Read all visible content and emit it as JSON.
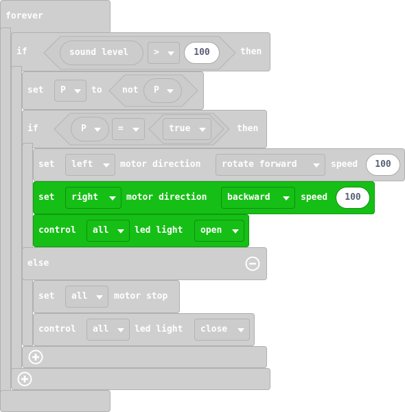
{
  "forever": {
    "label": "forever"
  },
  "if_outer": {
    "if_label": "if",
    "reporter": "sound level",
    "operator": ">",
    "value": "100",
    "then_label": "then"
  },
  "set_p": {
    "set_label": "set",
    "variable": "P",
    "to_label": "to",
    "not_label": "not",
    "not_arg": "P"
  },
  "if_inner": {
    "if_label": "if",
    "left_arg": "P",
    "operator": "=",
    "right_arg": "true",
    "then_label": "then"
  },
  "motor_left": {
    "set_label": "set",
    "side": "left",
    "motor_label": "motor direction",
    "direction": "rotate forward",
    "speed_label": "speed",
    "speed": "100"
  },
  "motor_right": {
    "set_label": "set",
    "side": "right",
    "motor_label": "motor direction",
    "direction": "backward",
    "speed_label": "speed",
    "speed": "100"
  },
  "led_open": {
    "control_label": "control",
    "target": "all",
    "led_label": "led light",
    "state": "open"
  },
  "else_label": "else",
  "motor_stop": {
    "set_label": "set",
    "target": "all",
    "stop_label": "motor stop"
  },
  "led_close": {
    "control_label": "control",
    "target": "all",
    "led_label": "led light",
    "state": "close"
  },
  "icons": {
    "dropdown": "caret-down-icon",
    "remove_else": "minus-circle-icon",
    "add_branch": "plus-circle-icon"
  },
  "colors": {
    "block_gray": "#cfcfcf",
    "block_green": "#16bf16",
    "number_text": "#575e75"
  }
}
